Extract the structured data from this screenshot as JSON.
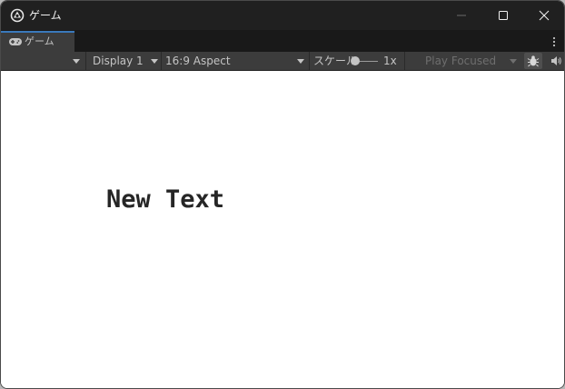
{
  "window": {
    "title": "ゲーム",
    "controls": [
      "minimize",
      "maximize",
      "close"
    ]
  },
  "tabs": {
    "active_label": "ゲーム",
    "active_icon": "gamepad-icon",
    "menu_icon": "kebab-menu-icon"
  },
  "toolbar": {
    "display": "Display 1",
    "aspect": "16:9 Aspect",
    "scale_label": "スケール",
    "scale_value": "1x",
    "scale_slider_fraction": 0,
    "play_mode": "Play Focused",
    "stats_icon": "bug-icon",
    "audio_icon": "speaker-icon"
  },
  "game": {
    "text": "New Text"
  },
  "colors": {
    "titlebar_bg": "#202020",
    "toolbar_bg": "#3c3c3c",
    "tab_accent": "#3a79bb",
    "game_bg": "#ffffff",
    "game_text": "#262626"
  }
}
